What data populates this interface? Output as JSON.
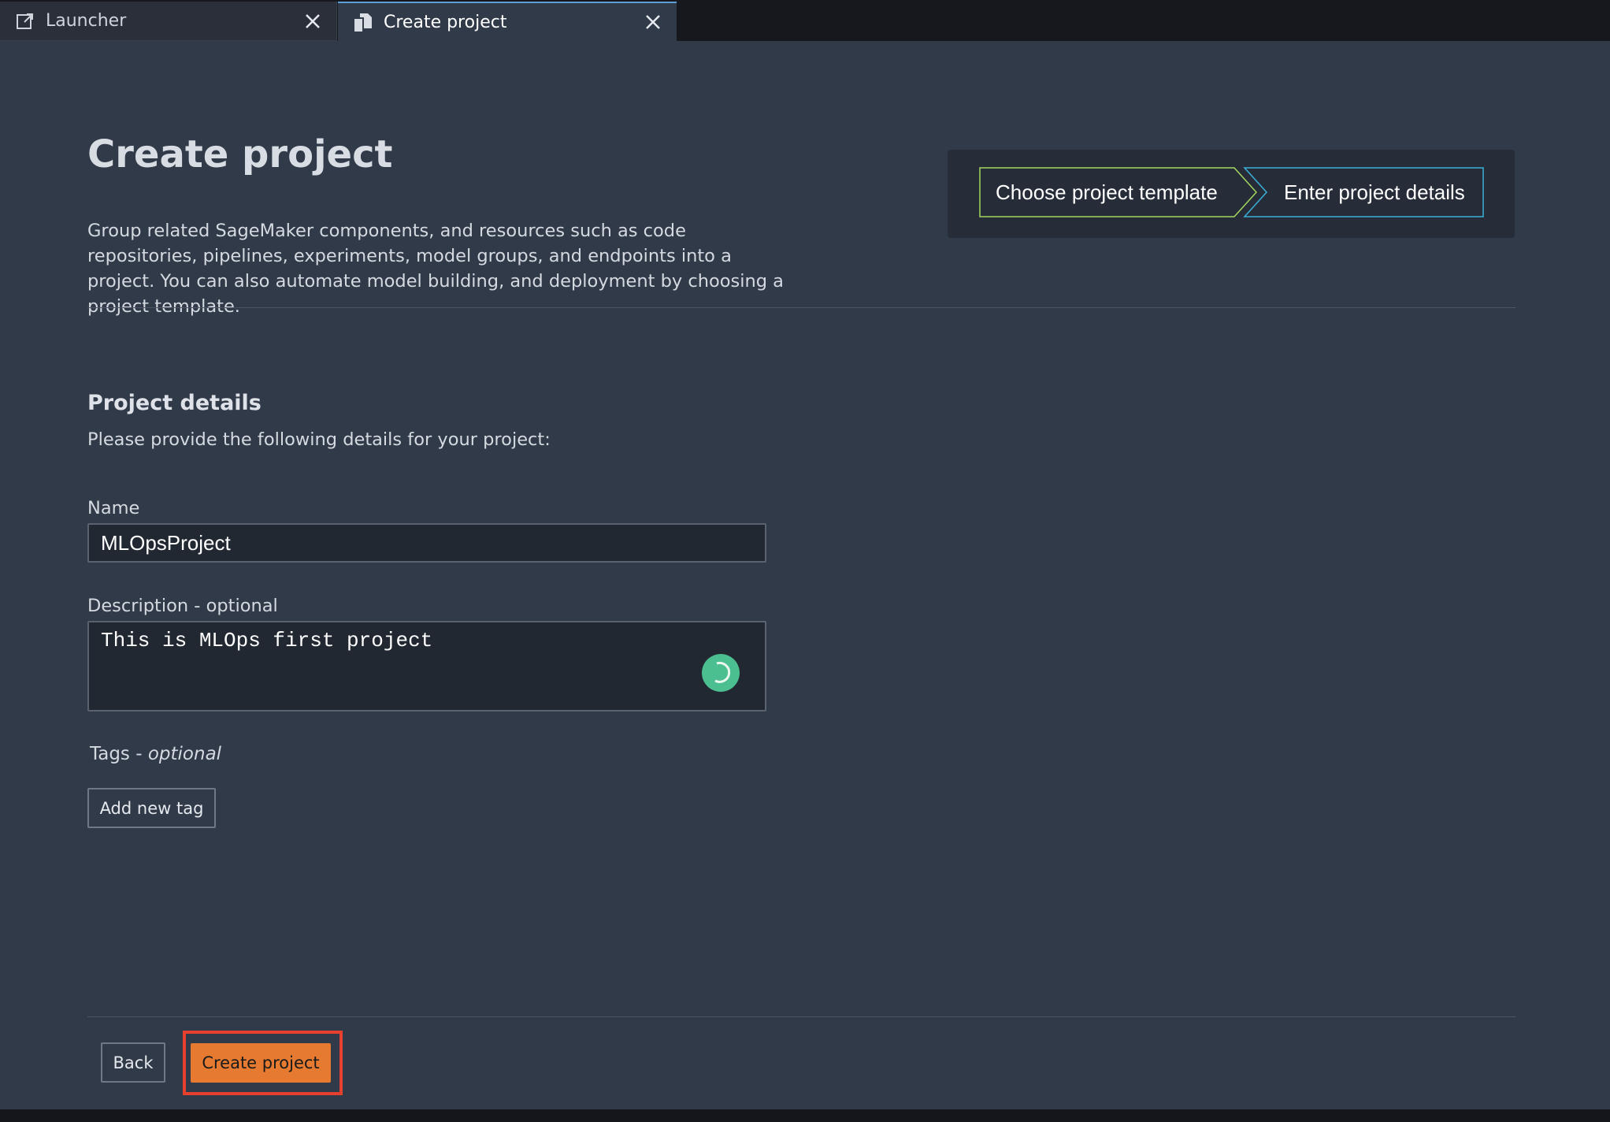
{
  "tabs": [
    {
      "label": "Launcher",
      "icon": "external-link-icon",
      "active": false
    },
    {
      "label": "Create project",
      "icon": "project-icon",
      "active": true
    }
  ],
  "page": {
    "title": "Create project",
    "description": "Group related SageMaker components, and resources such as code repositories, pipelines, experiments, model groups, and endpoints into a project. You can also automate model building, and deployment by choosing a project template."
  },
  "stepper": {
    "steps": [
      {
        "label": "Choose project template",
        "color": "#a4d65e"
      },
      {
        "label": "Enter project details",
        "color": "#3ab0d9"
      }
    ]
  },
  "details": {
    "title": "Project details",
    "subtitle": "Please provide the following details for your project:",
    "name_label": "Name",
    "name_value": "MLOpsProject",
    "description_label": "Description - optional",
    "description_value": "This is MLOps first project",
    "tags_label": "Tags - ",
    "tags_optional": "optional",
    "add_tag_label": "Add new tag"
  },
  "footer": {
    "back_label": "Back",
    "create_label": "Create project"
  },
  "colors": {
    "panel_bg": "#313a49",
    "primary_button": "#e57a30",
    "highlight": "#e8402e",
    "spinner": "#4cbf91"
  }
}
